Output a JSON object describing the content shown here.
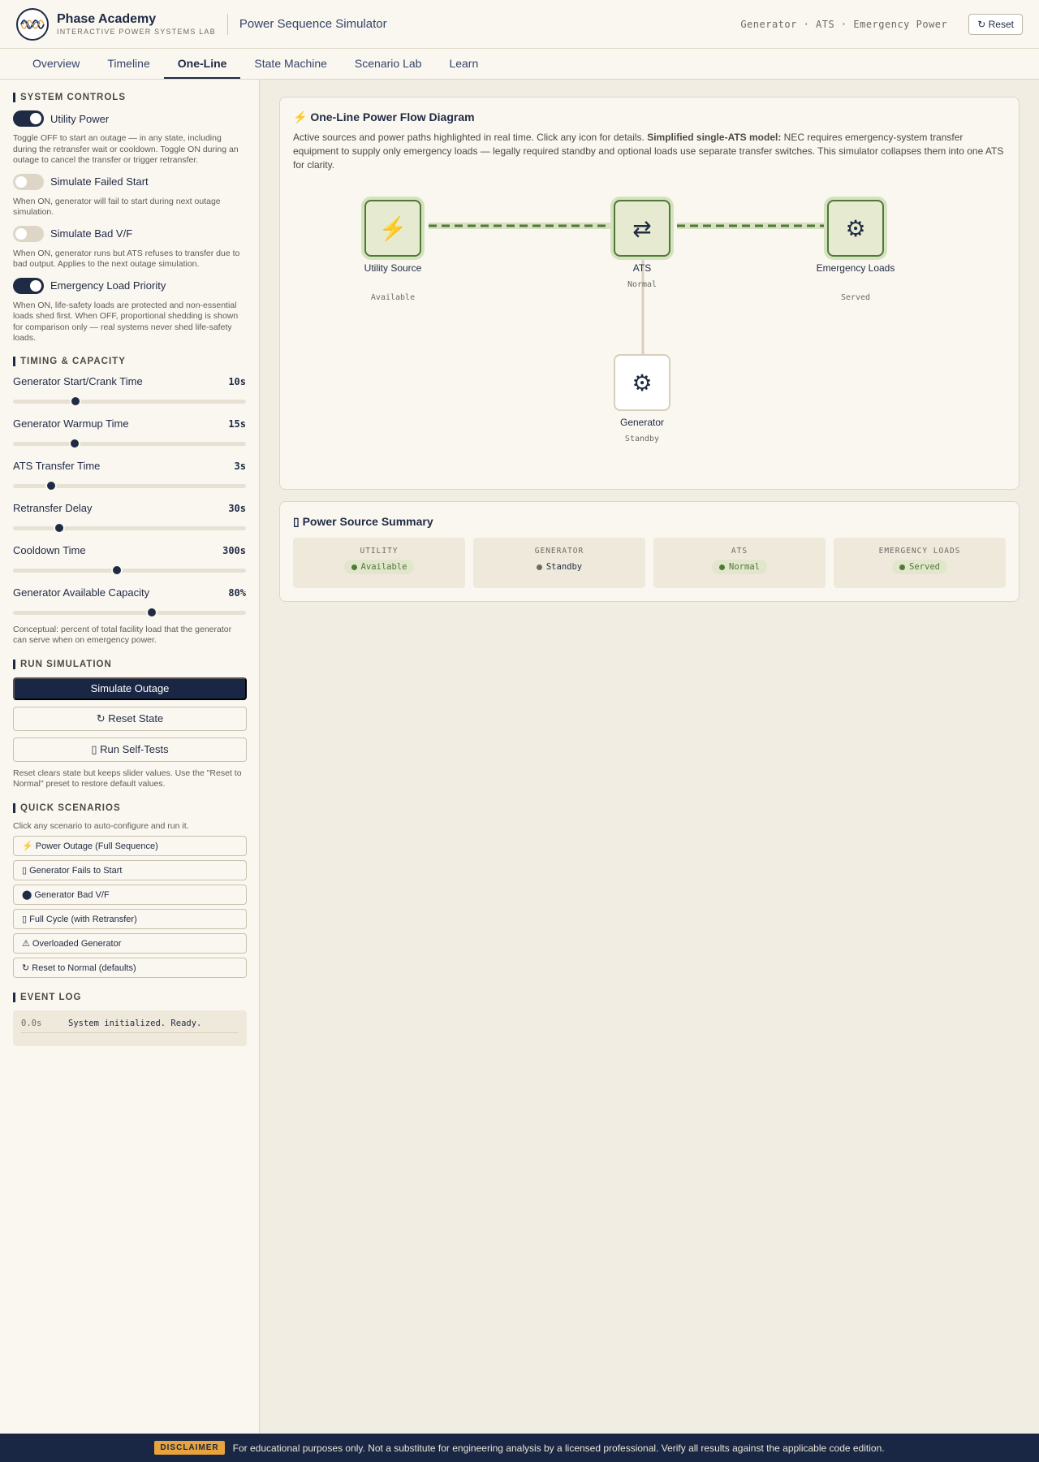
{
  "header": {
    "brand_name": "Phase Academy",
    "brand_sub": "INTERACTIVE POWER SYSTEMS LAB",
    "app_title": "Power Sequence Simulator",
    "crumbs": "Generator · ATS · Emergency Power",
    "reset_label": "↻ Reset"
  },
  "tabs": [
    {
      "label": "Overview"
    },
    {
      "label": "Timeline"
    },
    {
      "label": "One-Line",
      "active": true
    },
    {
      "label": "State Machine"
    },
    {
      "label": "Scenario Lab"
    },
    {
      "label": "Learn"
    }
  ],
  "sidebar": {
    "system_controls": {
      "title": "SYSTEM CONTROLS",
      "toggles": [
        {
          "label": "Utility Power",
          "on": true,
          "help": "Toggle OFF to start an outage — in any state, including during the retransfer wait or cooldown. Toggle ON during an outage to cancel the transfer or trigger retransfer."
        },
        {
          "label": "Simulate Failed Start",
          "on": false,
          "help": "When ON, generator will fail to start during next outage simulation."
        },
        {
          "label": "Simulate Bad V/F",
          "on": false,
          "help": "When ON, generator runs but ATS refuses to transfer due to bad output. Applies to the next outage simulation."
        },
        {
          "label": "Emergency Load Priority",
          "on": true,
          "help": "When ON, life-safety loads are protected and non-essential loads shed first. When OFF, proportional shedding is shown for comparison only — real systems never shed life-safety loads."
        }
      ]
    },
    "timing": {
      "title": "TIMING & CAPACITY",
      "sliders": [
        {
          "label": "Generator Start/Crank Time",
          "value": "10s",
          "fraction": 0.27
        },
        {
          "label": "Generator Warmup Time",
          "value": "15s",
          "fraction": 0.265
        },
        {
          "label": "ATS Transfer Time",
          "value": "3s",
          "fraction": 0.165
        },
        {
          "label": "Retransfer Delay",
          "value": "30s",
          "fraction": 0.2
        },
        {
          "label": "Cooldown Time",
          "value": "300s",
          "fraction": 0.445
        },
        {
          "label": "Generator Available Capacity",
          "value": "80%",
          "fraction": 0.595
        }
      ],
      "help": "Conceptual: percent of total facility load that the generator can serve when on emergency power."
    },
    "run": {
      "title": "RUN SIMULATION",
      "simulate_label": "Simulate Outage",
      "reset_state_label": "↻ Reset State",
      "self_tests_label": "▯ Run Self-Tests",
      "help": "Reset clears state but keeps slider values. Use the \"Reset to Normal\" preset to restore default values."
    },
    "scenarios": {
      "title": "QUICK SCENARIOS",
      "help": "Click any scenario to auto-configure and run it.",
      "items": [
        {
          "label": "⚡ Power Outage (Full Sequence)"
        },
        {
          "label": "▯ Generator Fails to Start"
        },
        {
          "label": "⬤ Generator Bad V/F"
        },
        {
          "label": "▯ Full Cycle (with Retransfer)"
        },
        {
          "label": "⚠ Overloaded Generator"
        },
        {
          "label": "↻ Reset to Normal (defaults)"
        }
      ]
    },
    "event_log": {
      "title": "EVENT LOG",
      "entries": [
        {
          "time": "0.0s",
          "message": "System initialized. Ready."
        }
      ]
    }
  },
  "diagram": {
    "title": "⚡ One-Line Power Flow Diagram",
    "desc_prefix": "Active sources and power paths highlighted in real time. Click any icon for details. ",
    "desc_bold": "Simplified single-ATS model:",
    "desc_suffix": " NEC requires emergency-system transfer equipment to supply only emergency loads — legally required standby and optional loads use separate transfer switches. This simulator collapses them into one ATS for clarity.",
    "nodes": {
      "utility": {
        "icon": "⚡",
        "label": "Utility Source",
        "status": "Available"
      },
      "ats": {
        "icon": "⇄",
        "label": "ATS",
        "status": "Normal"
      },
      "loads": {
        "icon": "⚙",
        "label": "Emergency Loads",
        "status": "Served"
      },
      "generator": {
        "icon": "⚙",
        "label": "Generator",
        "status": "Standby"
      }
    }
  },
  "summary": {
    "title": "▯ Power Source Summary",
    "items": [
      {
        "label": "UTILITY",
        "status": "Available"
      },
      {
        "label": "GENERATOR",
        "status": "Standby"
      },
      {
        "label": "ATS",
        "status": "Normal"
      },
      {
        "label": "EMERGENCY LOADS",
        "status": "Served"
      }
    ]
  },
  "footer": {
    "badge": "DISCLAIMER",
    "text": "For educational purposes only. Not a substitute for engineering analysis by a licensed professional. Verify all results against the applicable code edition."
  },
  "colors": {
    "navy": "#1a2744",
    "active_green": "#4f7a35",
    "badge_amber": "#e8a33d",
    "background": "#f2ede2"
  }
}
